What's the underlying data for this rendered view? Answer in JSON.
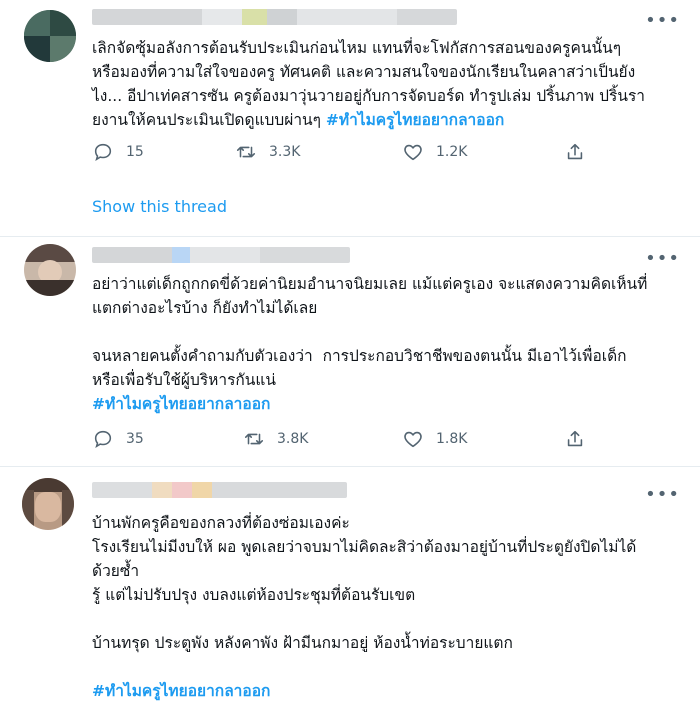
{
  "tweets": [
    {
      "text": "เลิกจัดซุ้มอลังการต้อนรับประเมินก่อนไหม แทนที่จะโฟกัสการสอนของครูคนนั้นๆ\nหรือมองที่ความใส่ใจของครู ทัศนคติ และความสนใจของนักเรียนในคลาสว่าเป็นยัง\nไง... อีปาเท่คสารซัน ครูต้องมาวุ่นวายอยู่กับการจัดบอร์ด ทำรูปเล่ม ปริ้นภาพ ปริ้นรา\nยงานให้คนประเมินเปิดดูแบบผ่านๆ ",
      "hashtag": "#ทำไมครูไทยอยากลาออก",
      "replies": "15",
      "retweets": "3.3K",
      "likes": "1.2K",
      "show_thread": "Show this thread"
    },
    {
      "text": "อย่าว่าแต่เด็กถูกกดขี่ด้วยค่านิยมอำนาจนิยมเลย แม้แต่ครูเอง จะแสดงความคิดเห็นที่\nแตกต่างอะไรบ้าง ก็ยังทำไม่ได้เลย\n\nจนหลายคนตั้งคำถามกับตัวเองว่า  การประกอบวิชาชีพของตนนั้น มีเอาไว้เพื่อเด็ก\nหรือเพื่อรับใช้ผู้บริหารกันแน่\n",
      "hashtag": "#ทำไมครูไทยอยากลาออก",
      "replies": "35",
      "retweets": "3.8K",
      "likes": "1.8K"
    },
    {
      "text": "บ้านพักครูคือของกลวงที่ต้องซ่อมเองค่ะ\nโรงเรียนไม่มีงบให้ ผอ พูดเลยว่าจบมาไม่คิดละสิว่าต้องมาอยู่บ้านที่ประตูยังปิดไม่ได้\nด้วยซ้ำ\nรู้ แต่ไม่ปรับปรุง งบลงแต่ห้องประชุมที่ต้อนรับเขต\n\nบ้านทรุด ประตูพัง หลังคาพัง ฝ้ามีนกมาอยู่ ห้องน้ำท่อระบายแตก\n\n",
      "hashtag": "#ทำไมครูไทยอยากลาออก"
    }
  ],
  "more_glyph": "•••",
  "icons": [
    "reply-icon",
    "retweet-icon",
    "like-icon",
    "share-icon",
    "more-options-icon"
  ],
  "colors": {
    "link": "#1d9bf0",
    "muted": "#536471",
    "divider": "#e6ecf0"
  }
}
